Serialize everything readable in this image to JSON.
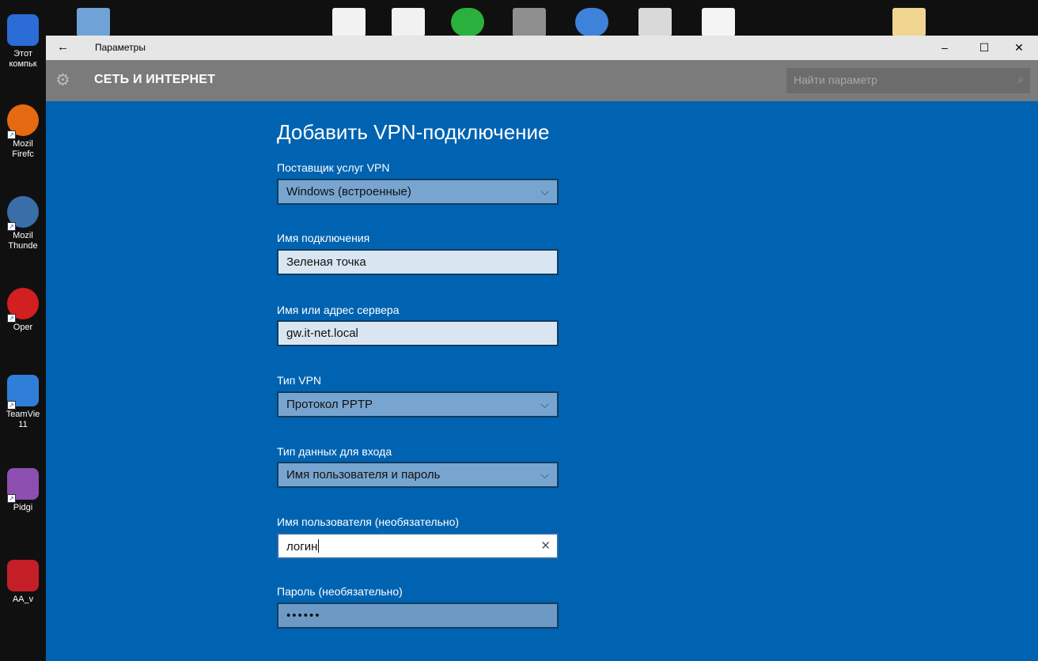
{
  "desktop": {
    "items": [
      {
        "label1": "Этот",
        "label2": "компьк",
        "color": "#2b6cd6"
      },
      {
        "label1": "Mozil",
        "label2": "Firefc",
        "color": "#e56a12"
      },
      {
        "label1": "Mozil",
        "label2": "Thunde",
        "color": "#3a6ea8"
      },
      {
        "label1": "Oper",
        "label2": "",
        "color": "#d21f1f"
      },
      {
        "label1": "TeamVie",
        "label2": "11",
        "color": "#2f7fd8"
      },
      {
        "label1": "Pidgi",
        "label2": "",
        "color": "#8c4fb0"
      },
      {
        "label1": "AA_v",
        "label2": "",
        "color": "#c41f26"
      }
    ]
  },
  "window": {
    "title": "Параметры",
    "back_icon": "←",
    "minimize_icon": "–",
    "maximize_icon": "☐",
    "close_icon": "✕"
  },
  "header": {
    "section": "СЕТЬ И ИНТЕРНЕТ",
    "search_placeholder": "Найти параметр",
    "gear_icon": "⚙",
    "search_icon": "⌕"
  },
  "form": {
    "heading": "Добавить VPN-подключение",
    "provider": {
      "label": "Поставщик услуг VPN",
      "value": "Windows (встроенные)"
    },
    "connection_name": {
      "label": "Имя подключения",
      "value": "Зеленая точка"
    },
    "server": {
      "label": "Имя или адрес сервера",
      "value": "gw.it-net.local"
    },
    "vpn_type": {
      "label": "Тип VPN",
      "value": "Протокол PPTP"
    },
    "signin_type": {
      "label": "Тип данных для входа",
      "value": "Имя пользователя и пароль"
    },
    "username": {
      "label": "Имя пользователя (необязательно)",
      "value": "логин"
    },
    "password": {
      "label": "Пароль (необязательно)",
      "value": "••••••"
    },
    "chevron_icon": "⌵",
    "clear_icon": "✕"
  }
}
